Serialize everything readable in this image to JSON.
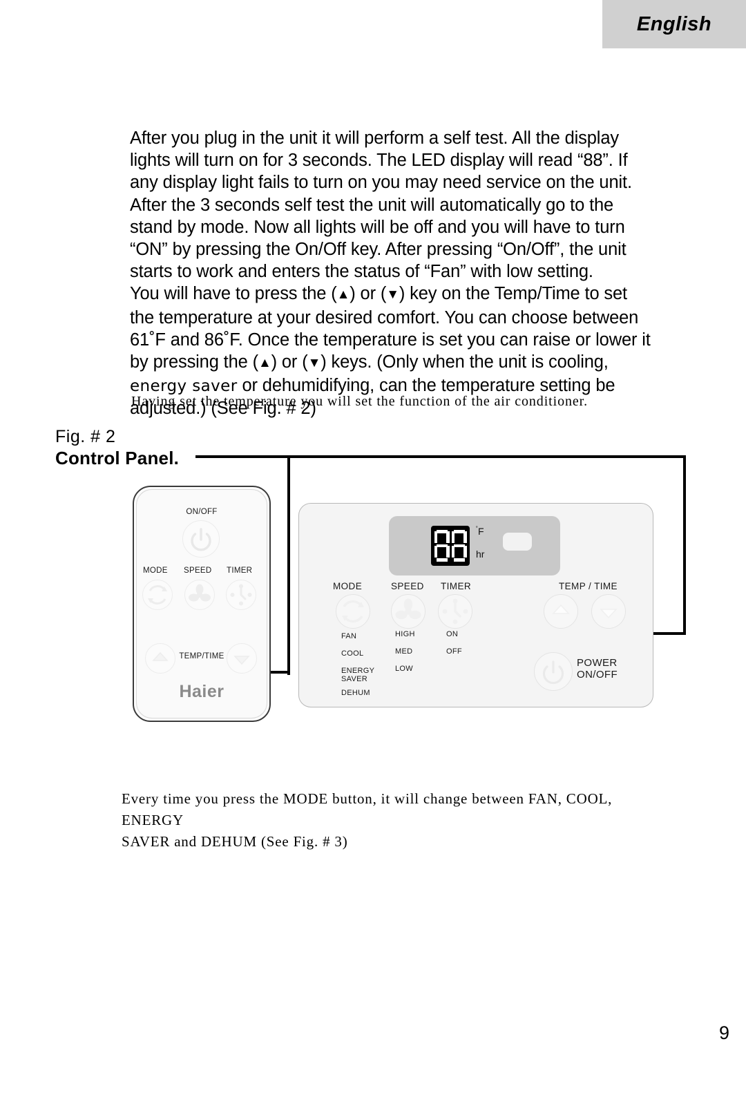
{
  "header": {
    "language_tab": "English",
    "tab_bg": "#d0d0d0"
  },
  "body": {
    "paragraph_1": "After you plug in the unit it will perform a self test. All the display lights will turn on for 3 seconds. The LED display will read “88”. If any display light fails to turn on you may need service on the unit. After the 3 seconds self test the unit will automatically go to the stand by mode. Now all lights will be off and you will have to turn “ON” by pressing the On/Off key. After pressing “On/Off”, the unit starts to work and enters the status of “Fan” with low setting.",
    "paragraph_2_a": "You will have to press the (",
    "up_arrow": "▲",
    "paragraph_2_b": ") or (",
    "down_arrow": "▼",
    "paragraph_2_c": ") key on the Temp/Time to set the temperature at your desired comfort. You can choose between 61˚F and 86˚F. Once the temperature is set you can raise or lower it by pressing the (",
    "paragraph_2_d": ") or (",
    "paragraph_2_e": ") keys. (Only when the unit is cooling, ",
    "paragraph_2_energy_saver": "energy saver",
    "paragraph_2_f": " or dehumidifying, can the temperature setting be adjusted.) (See Fig. # 2)",
    "caption_having": "Having set the temperature you will set the function of the air conditioner.",
    "closing_line_1": "Every time you press the MODE button, it will change between FAN, COOL, ENERGY",
    "closing_line_2": "SAVER and DEHUM (See Fig. # 3)"
  },
  "figure": {
    "fig_number": "Fig. #  2",
    "fig_title": "Control Panel."
  },
  "remote": {
    "on_off_label": "ON/OFF",
    "mode_label": "MODE",
    "speed_label": "SPEED",
    "timer_label": "TIMER",
    "temp_time_label": "TEMP/TIME",
    "brand": "Haier",
    "icons": {
      "power": "power-icon",
      "mode": "mode-cycle-icon",
      "speed": "fan-blade-icon",
      "timer": "clock-icon",
      "up": "up-arrow-icon",
      "down": "down-arrow-icon"
    }
  },
  "control_panel": {
    "led": {
      "value": "88",
      "unit_temp": "˚F",
      "unit_time": "hr"
    },
    "groups": [
      {
        "title": "MODE",
        "icon": "mode-cycle-icon",
        "options": [
          "FAN",
          "COOL",
          "ENERGY\nSAVER",
          "DEHUM"
        ]
      },
      {
        "title": "SPEED",
        "icon": "fan-blade-icon",
        "options": [
          "HIGH",
          "MED",
          "LOW"
        ]
      },
      {
        "title": "TIMER",
        "icon": "clock-icon",
        "options": [
          "ON",
          "OFF"
        ]
      }
    ],
    "mode_options": {
      "fan": "FAN",
      "cool": "COOL",
      "energy_saver_line1": "ENERGY",
      "energy_saver_line2": "SAVER",
      "dehum": "DEHUM"
    },
    "speed_options": {
      "high": "HIGH",
      "med": "MED",
      "low": "LOW"
    },
    "timer_options": {
      "on": "ON",
      "off": "OFF"
    },
    "mode_title": "MODE",
    "speed_title": "SPEED",
    "timer_title": "TIMER",
    "temp_time_title": "TEMP / TIME",
    "power_line1": "POWER",
    "power_line2": "ON/OFF"
  },
  "footer": {
    "page_number": "9"
  },
  "colors": {
    "page_bg": "#ffffff",
    "tab_gray": "#d0d0d0",
    "panel_bg": "#f4f4f4",
    "led_plate": "#c9c9c9",
    "led_bg": "#000000",
    "led_fg": "#ffffff",
    "brand_gray": "#8a8a8a"
  }
}
